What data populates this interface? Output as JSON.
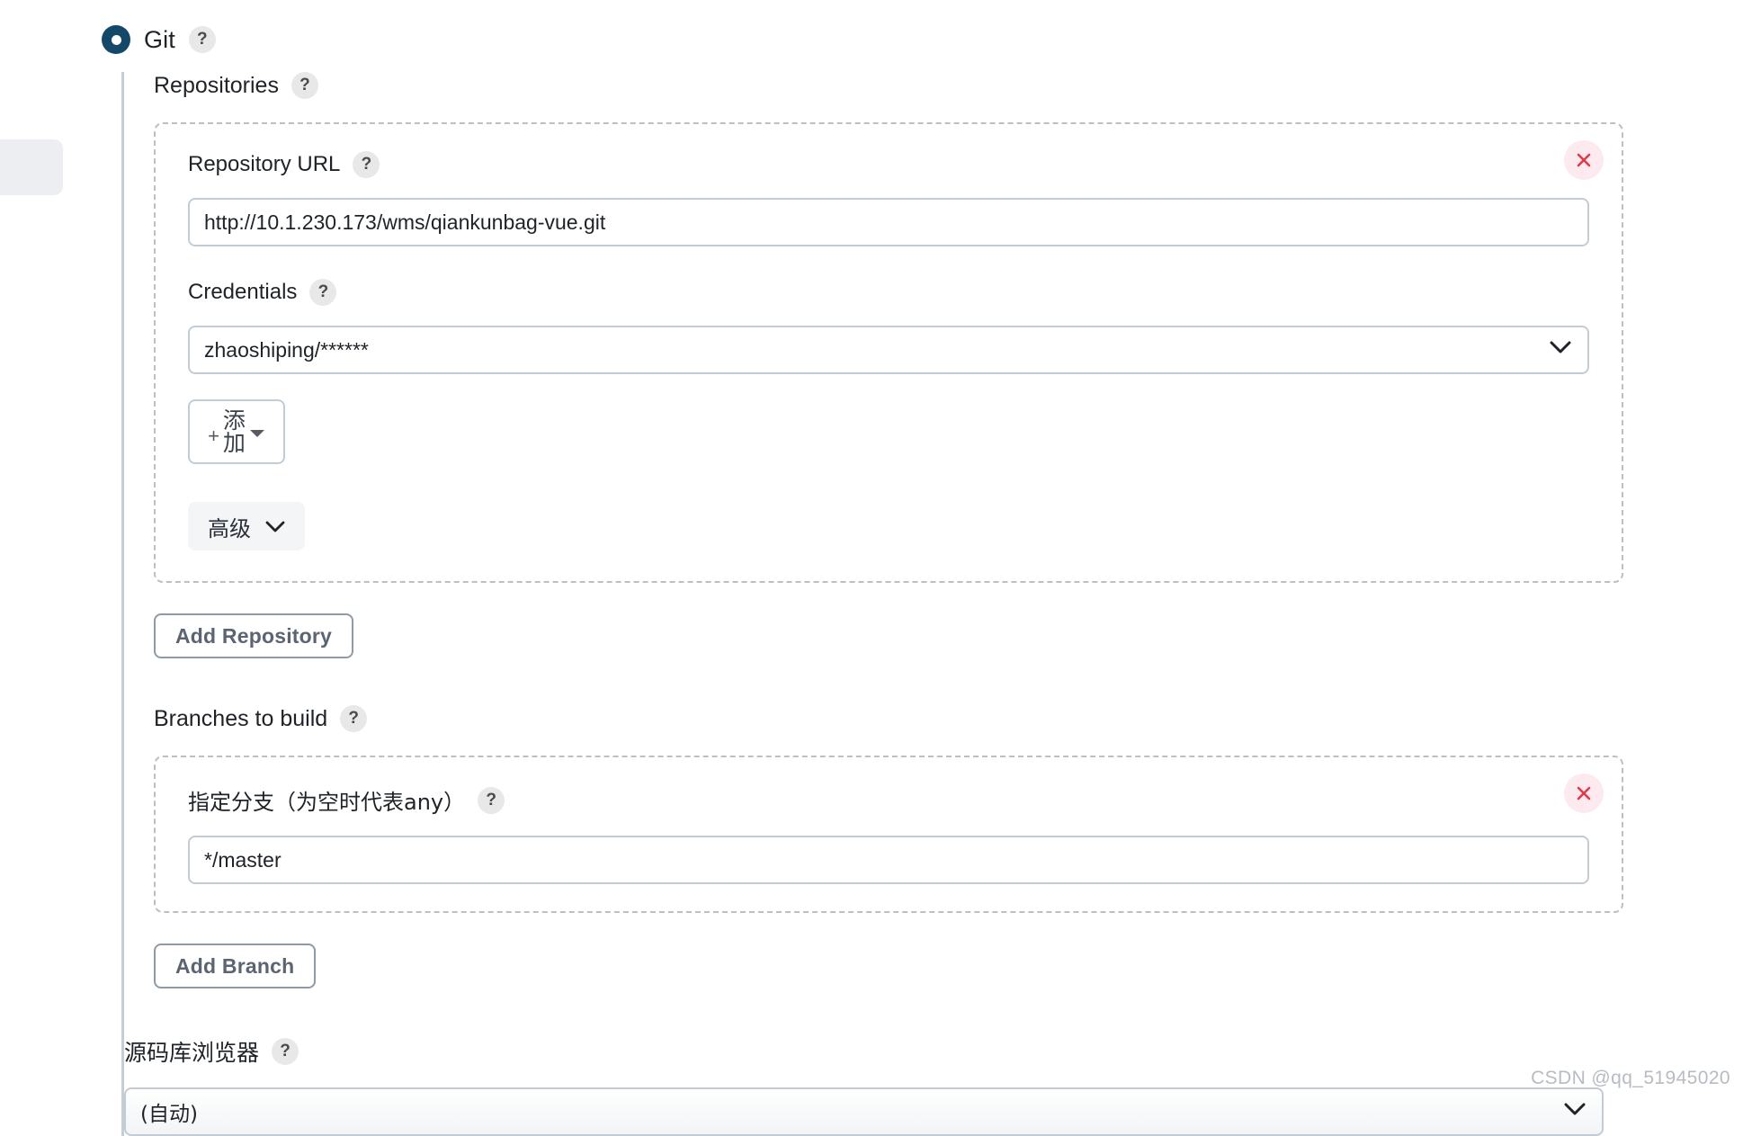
{
  "scm": {
    "selected_label": "Git",
    "help_glyph": "?",
    "radio_color": "#134868"
  },
  "repositories": {
    "section_label": "Repositories",
    "repo": {
      "url_label": "Repository URL",
      "url_value": "http://10.1.230.173/wms/qiankunbag-vue.git",
      "credentials_label": "Credentials",
      "credentials_value": "zhaoshiping/******",
      "add_credentials_plus": "+",
      "add_credentials_label_line1": "添",
      "add_credentials_label_line2": "加",
      "advanced_label": "高级",
      "delete_icon": "✕"
    },
    "add_repository_label": "Add Repository"
  },
  "branches": {
    "section_label": "Branches to build",
    "branch": {
      "specifier_label": "指定分支（为空时代表any）",
      "specifier_value": "*/master",
      "delete_icon": "✕"
    },
    "add_branch_label": "Add Branch"
  },
  "browser": {
    "section_label": "源码库浏览器",
    "selected_value": "(自动)"
  },
  "watermark": "CSDN @qq_51945020",
  "colors": {
    "accent": "#134868",
    "danger": "#e03a4e",
    "danger_bg": "#fdeaee",
    "border": "#c3ccd3",
    "dashed_border": "#b9c0c8",
    "rule": "#c7cdd4"
  }
}
